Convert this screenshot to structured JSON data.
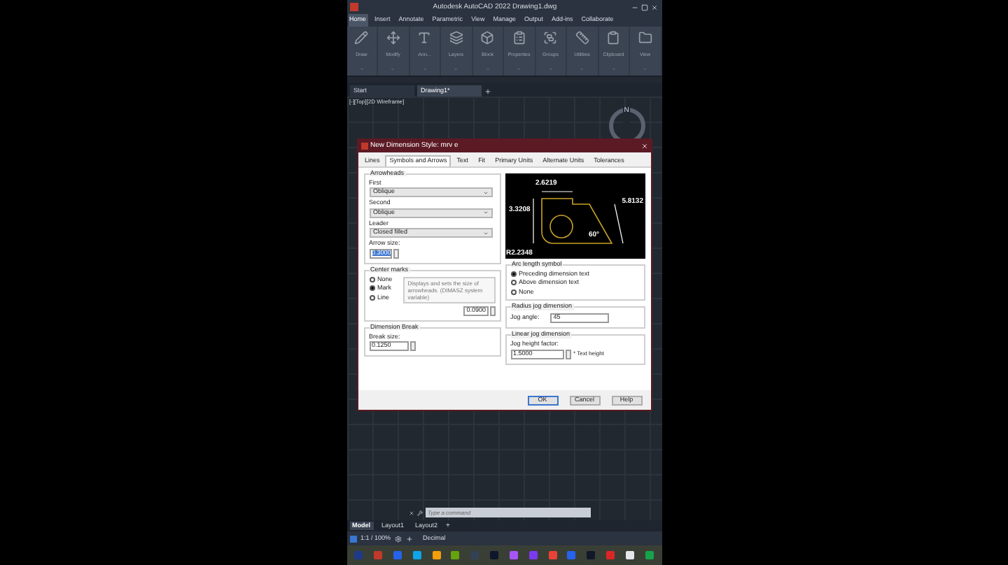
{
  "window": {
    "title": "Autodesk AutoCAD 2022   Drawing1.dwg"
  },
  "ribbon_tabs": [
    {
      "label": "Home",
      "selected": true
    },
    {
      "label": "Insert",
      "selected": false
    },
    {
      "label": "Annotate",
      "selected": false
    },
    {
      "label": "Parametric",
      "selected": false
    },
    {
      "label": "View",
      "selected": false
    },
    {
      "label": "Manage",
      "selected": false
    },
    {
      "label": "Output",
      "selected": false
    },
    {
      "label": "Add-ins",
      "selected": false
    },
    {
      "label": "Collaborate",
      "selected": false
    }
  ],
  "ribbon_panels": [
    {
      "label": "Draw",
      "kind": "draw"
    },
    {
      "label": "Modify",
      "kind": "modify"
    },
    {
      "label": "Ann...",
      "kind": "annotate"
    },
    {
      "label": "Layers",
      "kind": "layers"
    },
    {
      "label": "Block",
      "kind": "block"
    },
    {
      "label": "Properties",
      "kind": "properties"
    },
    {
      "label": "Groups",
      "kind": "groups"
    },
    {
      "label": "Utilities",
      "kind": "utilities"
    },
    {
      "label": "Clipboard",
      "kind": "clipboard"
    },
    {
      "label": "View",
      "kind": "view"
    }
  ],
  "file_tabs": [
    {
      "label": "Start",
      "selected": false
    },
    {
      "label": "Drawing1*",
      "selected": true
    }
  ],
  "viewport": {
    "label": "[-][Top][2D Wireframe]",
    "compass": "N"
  },
  "dialog": {
    "title": "New Dimension Style: mrv e",
    "tabs": [
      {
        "label": "Lines",
        "selected": false
      },
      {
        "label": "Symbols and Arrows",
        "selected": true
      },
      {
        "label": "Text",
        "selected": false
      },
      {
        "label": "Fit",
        "selected": false
      },
      {
        "label": "Primary Units",
        "selected": false
      },
      {
        "label": "Alternate Units",
        "selected": false
      },
      {
        "label": "Tolerances",
        "selected": false
      }
    ],
    "arrowheads": {
      "title": "Arrowheads",
      "fields": [
        {
          "label": "First",
          "value": "Oblique"
        },
        {
          "label": "Second",
          "value": "Oblique"
        },
        {
          "label": "Leader",
          "value": "Closed filled"
        }
      ],
      "size_label": "Arrow size:",
      "size_value": "0.3000"
    },
    "center_marks": {
      "title": "Center marks",
      "options": [
        {
          "label": "None",
          "selected": false
        },
        {
          "label": "Mark",
          "selected": true
        },
        {
          "label": "Line",
          "selected": false
        }
      ],
      "size_value": "0.0900"
    },
    "dimension_break": {
      "title": "Dimension Break",
      "label": "Break size:",
      "value": "0.1250"
    },
    "preview": {
      "labels": [
        "2.6219",
        "3.3208",
        "5.8132",
        "60°",
        "R2.2348"
      ]
    },
    "arc_length": {
      "title": "Arc length symbol",
      "options": [
        {
          "label": "Preceding dimension text",
          "selected": true
        },
        {
          "label": "Above dimension text",
          "selected": false
        },
        {
          "label": "None",
          "selected": false
        }
      ]
    },
    "radius_jog": {
      "title": "Radius jog dimension",
      "label": "Jog angle:",
      "value": "45"
    },
    "linear_jog": {
      "title": "Linear jog dimension",
      "label": "Jog height factor:",
      "value": "1.5000",
      "suffix": "* Text height"
    },
    "tooltip": "Displays and sets the size of arrowheads. (DIMASZ system variable)",
    "buttons": [
      "OK",
      "Cancel",
      "Help"
    ]
  },
  "command_line": {
    "placeholder": "Type a command"
  },
  "layout_tabs": [
    {
      "label": "Model",
      "selected": true
    },
    {
      "label": "Layout1",
      "selected": false
    },
    {
      "label": "Layout2",
      "selected": false
    }
  ],
  "layout_add": "+",
  "status_bar": {
    "scale": "1:1 / 100%",
    "units": "Decimal"
  }
}
